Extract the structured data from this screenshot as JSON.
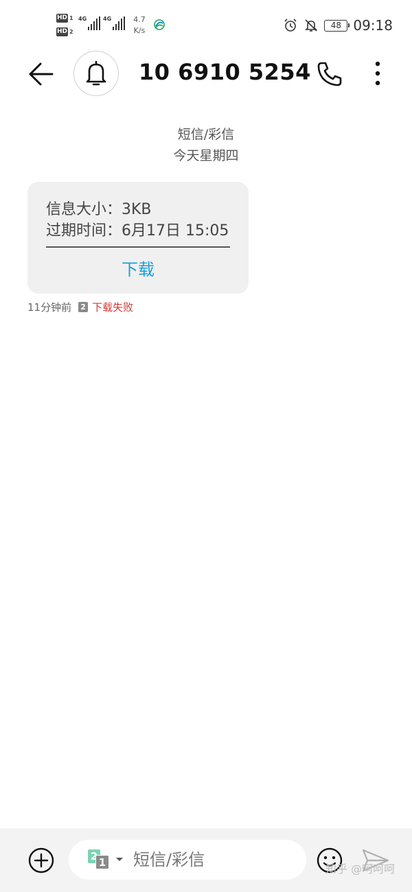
{
  "status_bar": {
    "sim1_label": "HD",
    "sim1_num": "1",
    "sim2_label": "HD",
    "sim2_num": "2",
    "net1": "4G",
    "net2": "4G",
    "speed_value": "4.7",
    "speed_unit": "K/s",
    "battery": "48",
    "time": "09:18"
  },
  "header": {
    "title": "10 6910 5254",
    "icons": {
      "back": "back-arrow-icon",
      "avatar": "bell-icon",
      "call": "phone-icon",
      "more": "more-vertical-icon"
    }
  },
  "conversation": {
    "type_label": "短信/彩信",
    "day_label": "今天星期四"
  },
  "message": {
    "size_line": "信息大小：3KB",
    "expiry_line": "过期时间：6月17日 15:05",
    "action_label": "下载",
    "time_ago": "11分钟前",
    "sim_badge": "2",
    "status": "下载失败"
  },
  "composer": {
    "sim_back": "2",
    "sim_front": "1",
    "placeholder": "短信/彩信",
    "watermark": "知乎 @呵呵呵"
  },
  "colors": {
    "accent": "#1a9fd8",
    "error": "#d23a35",
    "bubble_bg": "#f0f0f0",
    "sim1_green": "#7dd3b1"
  }
}
